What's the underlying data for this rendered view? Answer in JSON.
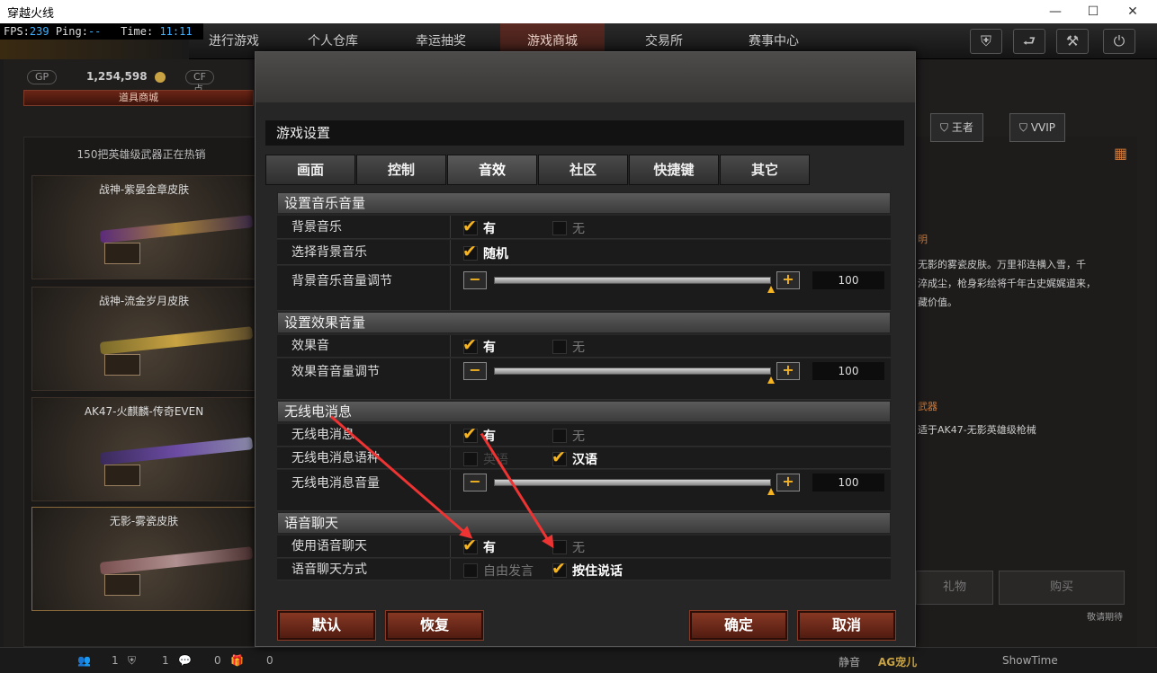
{
  "window": {
    "title": "穿越火线",
    "minimize": "—",
    "maximize": "☐",
    "close": "✕"
  },
  "hud": {
    "fps_label": "FPS:",
    "fps": "239",
    "ping_label": "Ping:",
    "ping": "--",
    "time_label": "Time:",
    "time": "11:11"
  },
  "topnav": {
    "tabs": [
      "进行游戏",
      "个人仓库",
      "幸运抽奖",
      "游戏商城",
      "交易所",
      "赛事中心"
    ],
    "active": "游戏商城"
  },
  "currency": {
    "gp_label": "GP",
    "gp_value": "1,254,598",
    "cf_label": "CF点"
  },
  "shop_tab": "道具商城",
  "left_panel": {
    "promo": "150把英雄级武器正在热销",
    "items": [
      "战神-紫晏金章皮肤",
      "战神-流金岁月皮肤",
      "AK47-火麒麟-传奇EVEN",
      "无影-雾瓷皮肤"
    ]
  },
  "right_panel": {
    "tags": [
      "王者",
      "VVIP"
    ],
    "desc_lines": [
      "明",
      "无影的雾瓷皮肤。万里祁连横入雪，千",
      "淬成尘，枪身彩绘将千年古史娓娓道来，",
      "藏价值。"
    ],
    "weapon_title": "武器",
    "weapon_desc": "适于AK47-无影英雄级枪械",
    "gift_label": "礼物",
    "buy_label": "购买",
    "tip": "敬请期待"
  },
  "bottombar": {
    "c1": "1",
    "c2": "1",
    "c3": "0",
    "c4": "0",
    "mute": "静音",
    "brand": "AG宠儿",
    "showtime": "ShowTime"
  },
  "dialog": {
    "title": "游戏设置",
    "tabs": [
      "画面",
      "控制",
      "音效",
      "社区",
      "快捷键",
      "其它"
    ],
    "active_tab": "音效",
    "sections": {
      "music": {
        "header": "设置音乐音量",
        "bgm_label": "背景音乐",
        "bgm_yes": "有",
        "bgm_no": "无",
        "select_label": "选择背景音乐",
        "select_random": "随机",
        "volume_label": "背景音乐音量调节",
        "volume_value": "100"
      },
      "effects": {
        "header": "设置效果音量",
        "sfx_label": "效果音",
        "sfx_yes": "有",
        "sfx_no": "无",
        "volume_label": "效果音音量调节",
        "volume_value": "100"
      },
      "radio": {
        "header": "无线电消息",
        "msg_label": "无线电消息",
        "msg_yes": "有",
        "msg_no": "无",
        "lang_label": "无线电消息语种",
        "lang_other": "英语",
        "lang_cn": "汉语",
        "volume_label": "无线电消息音量",
        "volume_value": "100"
      },
      "voice": {
        "header": "语音聊天",
        "use_label": "使用语音聊天",
        "use_yes": "有",
        "use_no": "无",
        "mode_label": "语音聊天方式",
        "mode_free": "自由发言",
        "mode_ptt": "按住说话"
      }
    },
    "buttons": {
      "default": "默认",
      "restore": "恢复",
      "ok": "确定",
      "cancel": "取消"
    },
    "slider_level": {
      "music": 1.0,
      "effects": 1.0,
      "radio": 1.0
    },
    "accent_color": "#f6b520"
  }
}
